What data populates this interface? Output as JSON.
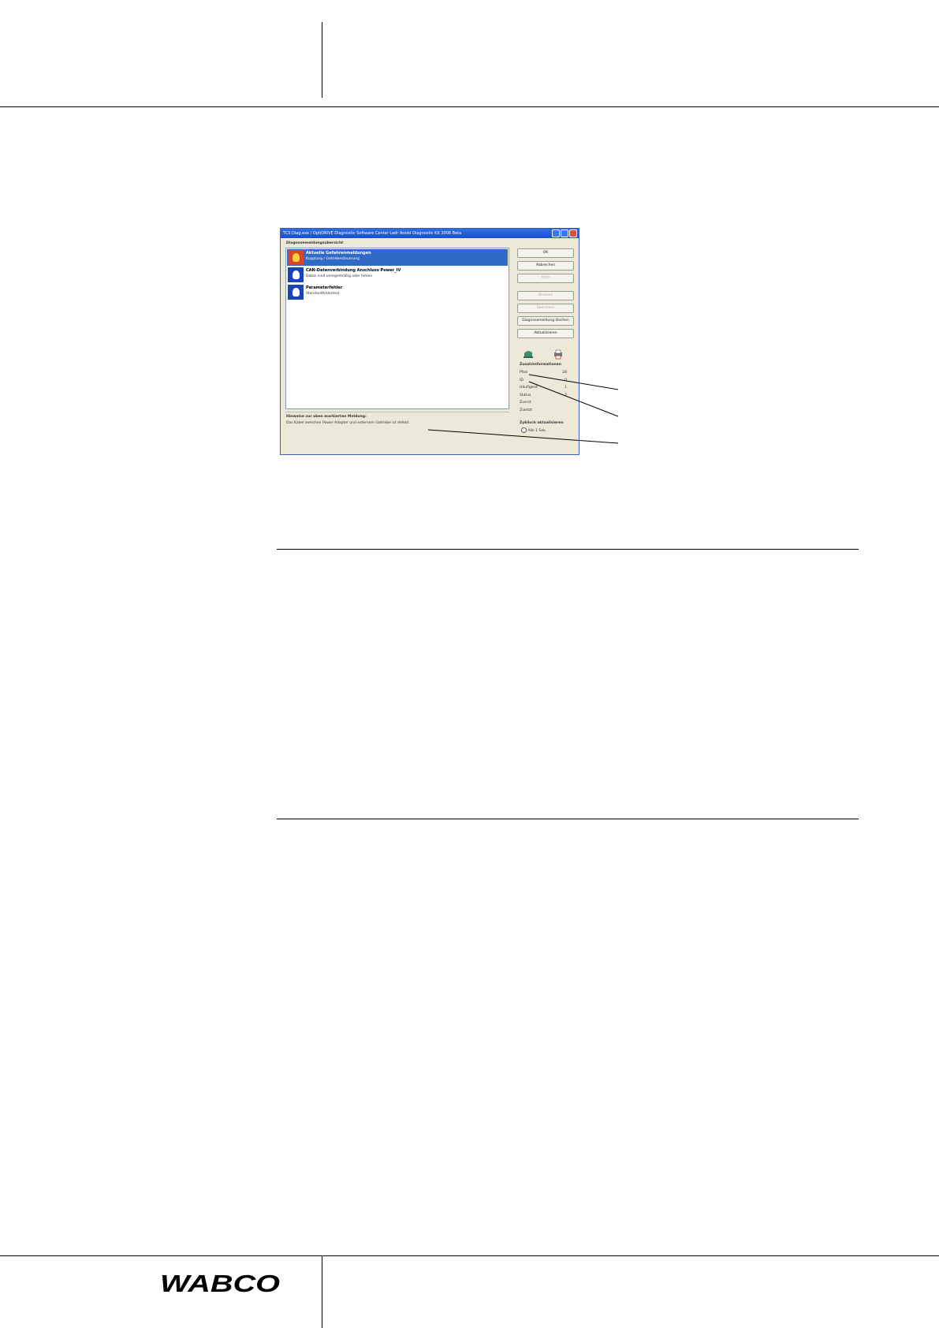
{
  "window": {
    "title": "TCS Diag.exe / OptiDRIVE Diagnostic Software Center Ladr Assist Diagnostic Kit 2006 Beta",
    "list_title": "Diagnosemeldungsübersicht",
    "messages": [
      {
        "title": "Aktuelle Gefahrenmeldungen",
        "subtitle": "Kupplung / Getriebesteuerung",
        "icon": "warning-bulb-icon",
        "selected": true
      },
      {
        "title": "CAN-Datenverbindung Anschluss Power_IV",
        "subtitle": "Daten sind unregelmäßig oder fehlen",
        "icon": "info-bulb-icon",
        "selected": false
      },
      {
        "title": "Parameterfehler",
        "subtitle": "Standardfehlertext",
        "icon": "info-bulb-icon",
        "selected": false
      }
    ],
    "buttons": [
      {
        "label": "OK",
        "enabled": true
      },
      {
        "label": "Abbrechen",
        "enabled": true
      },
      {
        "label": "Hilfe",
        "enabled": false
      },
      {
        "label": "Drucken",
        "enabled": false
      },
      {
        "label": "Speichern",
        "enabled": false
      },
      {
        "label": "Diagnosemeldung löschen",
        "enabled": true
      },
      {
        "label": "Aktualisieren",
        "enabled": true
      }
    ],
    "info_title": "Zusatzinformationen",
    "info_rows": [
      {
        "label": "Pfad",
        "value": "28"
      },
      {
        "label": "ID",
        "value": "0"
      },
      {
        "label": "Häufigkeit",
        "value": "1"
      },
      {
        "label": "Status",
        "value": "2"
      },
      {
        "label": "Zuerst",
        "value": ""
      },
      {
        "label": "Zuletzt",
        "value": ""
      }
    ],
    "status_title": "Hinweise zur oben markierten Meldung:",
    "status_text": "Das Kabel zwischen Power Adapter und externem Getriebe ist defekt.",
    "refresh_title": "Zyklisch aktualisieren",
    "refresh_option": "Alle 1 Sek."
  }
}
